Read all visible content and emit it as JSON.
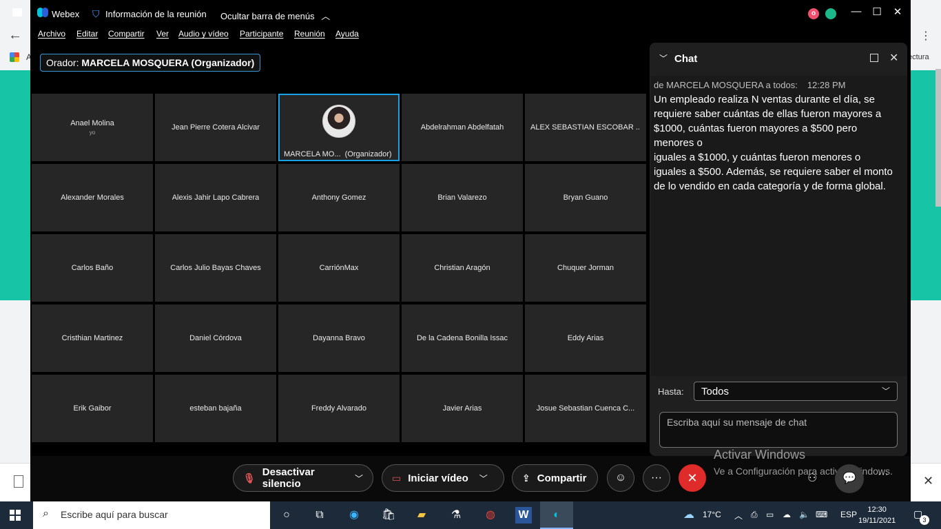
{
  "background_browser": {
    "partial_text_left": "A",
    "partial_text_right": "ectura"
  },
  "titlebar": {
    "app_name": "Webex",
    "meeting_info": "Información de la reunión",
    "hide_menu": "Ocultar barra de menús",
    "status_badge": "o"
  },
  "menu": [
    "Archivo",
    "Editar",
    "Compartir",
    "Ver",
    "Audio y vídeo",
    "Participante",
    "Reunión",
    "Ayuda"
  ],
  "speaker": {
    "label": "Orador:",
    "name": "MARCELA MOSQUERA (Organizador)"
  },
  "participants": [
    {
      "name": "Anael Molina",
      "sub": "yo"
    },
    {
      "name": "Jean Pierre Cotera Alcivar"
    },
    {
      "name": "MARCELA MO...",
      "org": "(Organizador)",
      "active": true
    },
    {
      "name": "Abdelrahman Abdelfatah"
    },
    {
      "name": "ALEX SEBASTIAN ESCOBAR ..."
    },
    {
      "name": "Alexander Morales"
    },
    {
      "name": "Alexis Jahir Lapo Cabrera"
    },
    {
      "name": "Anthony Gomez"
    },
    {
      "name": "Brian Valarezo"
    },
    {
      "name": "Bryan Guano"
    },
    {
      "name": "Carlos Baño"
    },
    {
      "name": "Carlos Julio Bayas Chaves"
    },
    {
      "name": "CarriónMax"
    },
    {
      "name": "Christian Aragón"
    },
    {
      "name": "Chuquer Jorman"
    },
    {
      "name": "Cristhian Martinez"
    },
    {
      "name": "Daniel Córdova"
    },
    {
      "name": "Dayanna Bravo"
    },
    {
      "name": "De la Cadena Bonilla Issac"
    },
    {
      "name": "Eddy Arias"
    },
    {
      "name": "Erik Gaibor"
    },
    {
      "name": "esteban bajaña"
    },
    {
      "name": "Freddy Alvarado"
    },
    {
      "name": "Javier Arias"
    },
    {
      "name": "Josue Sebastian Cuenca C..."
    }
  ],
  "chat": {
    "title": "Chat",
    "meta_from": "de MARCELA MOSQUERA a todos:",
    "meta_time": "12:28 PM",
    "message": "Un empleado realiza N ventas durante el día, se requiere saber cuántas de ellas fueron mayores a $1000, cuántas fueron mayores a $500 pero menores o\niguales a $1000, y cuántas fueron menores o iguales a $500. Además, se requiere saber el monto de lo vendido en cada categoría y de forma global.",
    "to_label": "Hasta:",
    "to_value": "Todos",
    "input_placeholder": "Escriba aquí su mensaje de chat"
  },
  "controls": {
    "mute": "Desactivar silencio",
    "video": "Iniciar vídeo",
    "share": "Compartir"
  },
  "watermark": {
    "line1": "Activar Windows",
    "line2": "Ve a Configuración para activar Windows."
  },
  "taskbar": {
    "search_placeholder": "Escribe aquí para buscar",
    "weather": "17°C",
    "lang": "ESP",
    "time": "12:30",
    "date": "19/11/2021",
    "notifications": "3"
  },
  "colors": {
    "accent": "#1aa2e6",
    "end_call": "#e02b2b",
    "teal_background": "#17c4a5"
  }
}
